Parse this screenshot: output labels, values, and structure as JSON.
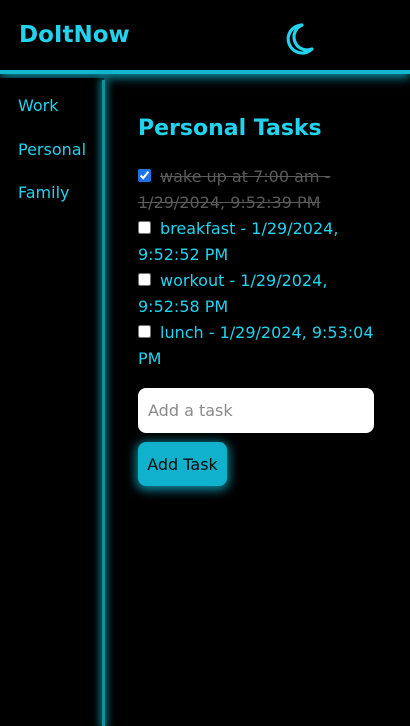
{
  "app": {
    "brand": "DoItNow",
    "theme_icon": "moon-icon"
  },
  "colors": {
    "accent": "#22d3ee",
    "accent_dark": "#0fb1cc",
    "background": "#000000",
    "checkbox": "#1a73e8"
  },
  "sidebar": {
    "items": [
      {
        "label": "Work"
      },
      {
        "label": "Personal"
      },
      {
        "label": "Family"
      }
    ]
  },
  "main": {
    "title": "Personal Tasks",
    "tasks": [
      {
        "text": "wake up at 7:00 am - 1/29/2024, 9:52:39 PM",
        "checked": true
      },
      {
        "text": "breakfast - 1/29/2024, 9:52:52 PM",
        "checked": false
      },
      {
        "text": "workout - 1/29/2024, 9:52:58 PM",
        "checked": false
      },
      {
        "text": "lunch - 1/29/2024, 9:53:04 PM",
        "checked": false
      }
    ],
    "input_placeholder": "Add a task",
    "input_value": "",
    "add_button_label": "Add Task"
  }
}
